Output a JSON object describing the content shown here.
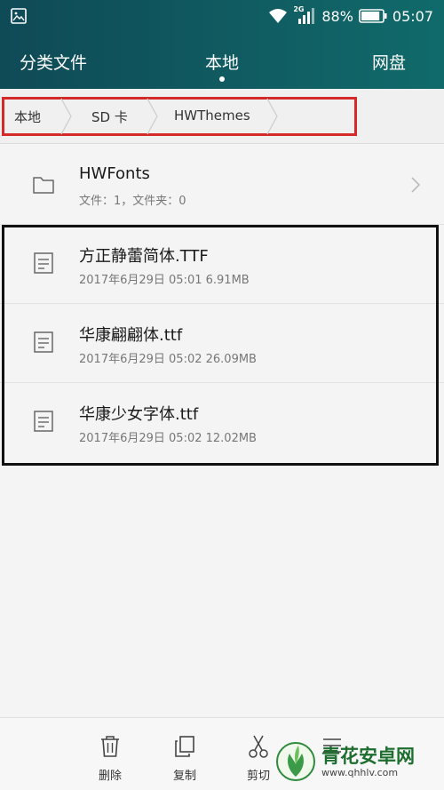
{
  "status_bar": {
    "network": "2G",
    "battery_percent": "88%",
    "battery_level": 0.88,
    "time": "05:07",
    "icons": [
      "gallery-icon",
      "wifi-icon",
      "signal-icon",
      "battery-icon"
    ]
  },
  "tabs": [
    {
      "label": "分类文件",
      "active": false
    },
    {
      "label": "本地",
      "active": true
    },
    {
      "label": "网盘",
      "active": false
    }
  ],
  "breadcrumb": [
    "本地",
    "SD 卡",
    "HWThemes"
  ],
  "items": [
    {
      "type": "folder",
      "name": "HWFonts",
      "meta": "文件：1，文件夹：0"
    },
    {
      "type": "file",
      "name": "方正静蕾简体.TTF",
      "meta": "2017年6月29日 05:01 6.91MB"
    },
    {
      "type": "file",
      "name": "华康翩翩体.ttf",
      "meta": "2017年6月29日 05:02 26.09MB"
    },
    {
      "type": "file",
      "name": "华康少女字体.ttf",
      "meta": "2017年6月29日 05:02 12.02MB"
    }
  ],
  "actions": [
    {
      "label": "删除",
      "icon": "trash-icon"
    },
    {
      "label": "复制",
      "icon": "copy-icon"
    },
    {
      "label": "剪切",
      "icon": "scissors-icon"
    },
    {
      "label": "",
      "icon": "more-icon"
    }
  ],
  "watermark": {
    "title": "青花安卓网",
    "url": "www.qhhlv.com"
  },
  "colors": {
    "header_start": "#0f4a57",
    "header_end": "#106a6a",
    "highlight_red": "#d42a2a",
    "highlight_black": "#111111",
    "watermark_green": "#1d6e2f"
  }
}
